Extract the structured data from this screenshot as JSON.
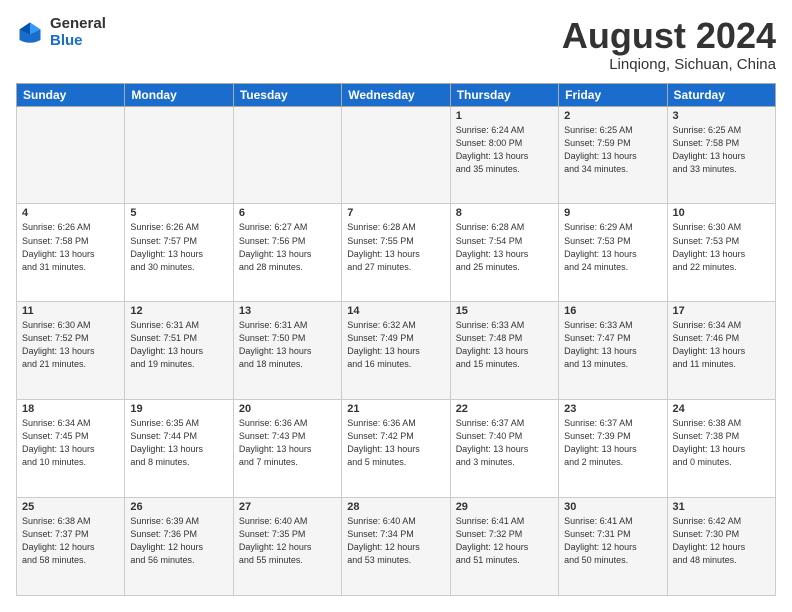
{
  "logo": {
    "general": "General",
    "blue": "Blue"
  },
  "title": "August 2024",
  "location": "Linqiong, Sichuan, China",
  "weekdays": [
    "Sunday",
    "Monday",
    "Tuesday",
    "Wednesday",
    "Thursday",
    "Friday",
    "Saturday"
  ],
  "weeks": [
    [
      {
        "day": "",
        "info": ""
      },
      {
        "day": "",
        "info": ""
      },
      {
        "day": "",
        "info": ""
      },
      {
        "day": "",
        "info": ""
      },
      {
        "day": "1",
        "info": "Sunrise: 6:24 AM\nSunset: 8:00 PM\nDaylight: 13 hours\nand 35 minutes."
      },
      {
        "day": "2",
        "info": "Sunrise: 6:25 AM\nSunset: 7:59 PM\nDaylight: 13 hours\nand 34 minutes."
      },
      {
        "day": "3",
        "info": "Sunrise: 6:25 AM\nSunset: 7:58 PM\nDaylight: 13 hours\nand 33 minutes."
      }
    ],
    [
      {
        "day": "4",
        "info": "Sunrise: 6:26 AM\nSunset: 7:58 PM\nDaylight: 13 hours\nand 31 minutes."
      },
      {
        "day": "5",
        "info": "Sunrise: 6:26 AM\nSunset: 7:57 PM\nDaylight: 13 hours\nand 30 minutes."
      },
      {
        "day": "6",
        "info": "Sunrise: 6:27 AM\nSunset: 7:56 PM\nDaylight: 13 hours\nand 28 minutes."
      },
      {
        "day": "7",
        "info": "Sunrise: 6:28 AM\nSunset: 7:55 PM\nDaylight: 13 hours\nand 27 minutes."
      },
      {
        "day": "8",
        "info": "Sunrise: 6:28 AM\nSunset: 7:54 PM\nDaylight: 13 hours\nand 25 minutes."
      },
      {
        "day": "9",
        "info": "Sunrise: 6:29 AM\nSunset: 7:53 PM\nDaylight: 13 hours\nand 24 minutes."
      },
      {
        "day": "10",
        "info": "Sunrise: 6:30 AM\nSunset: 7:53 PM\nDaylight: 13 hours\nand 22 minutes."
      }
    ],
    [
      {
        "day": "11",
        "info": "Sunrise: 6:30 AM\nSunset: 7:52 PM\nDaylight: 13 hours\nand 21 minutes."
      },
      {
        "day": "12",
        "info": "Sunrise: 6:31 AM\nSunset: 7:51 PM\nDaylight: 13 hours\nand 19 minutes."
      },
      {
        "day": "13",
        "info": "Sunrise: 6:31 AM\nSunset: 7:50 PM\nDaylight: 13 hours\nand 18 minutes."
      },
      {
        "day": "14",
        "info": "Sunrise: 6:32 AM\nSunset: 7:49 PM\nDaylight: 13 hours\nand 16 minutes."
      },
      {
        "day": "15",
        "info": "Sunrise: 6:33 AM\nSunset: 7:48 PM\nDaylight: 13 hours\nand 15 minutes."
      },
      {
        "day": "16",
        "info": "Sunrise: 6:33 AM\nSunset: 7:47 PM\nDaylight: 13 hours\nand 13 minutes."
      },
      {
        "day": "17",
        "info": "Sunrise: 6:34 AM\nSunset: 7:46 PM\nDaylight: 13 hours\nand 11 minutes."
      }
    ],
    [
      {
        "day": "18",
        "info": "Sunrise: 6:34 AM\nSunset: 7:45 PM\nDaylight: 13 hours\nand 10 minutes."
      },
      {
        "day": "19",
        "info": "Sunrise: 6:35 AM\nSunset: 7:44 PM\nDaylight: 13 hours\nand 8 minutes."
      },
      {
        "day": "20",
        "info": "Sunrise: 6:36 AM\nSunset: 7:43 PM\nDaylight: 13 hours\nand 7 minutes."
      },
      {
        "day": "21",
        "info": "Sunrise: 6:36 AM\nSunset: 7:42 PM\nDaylight: 13 hours\nand 5 minutes."
      },
      {
        "day": "22",
        "info": "Sunrise: 6:37 AM\nSunset: 7:40 PM\nDaylight: 13 hours\nand 3 minutes."
      },
      {
        "day": "23",
        "info": "Sunrise: 6:37 AM\nSunset: 7:39 PM\nDaylight: 13 hours\nand 2 minutes."
      },
      {
        "day": "24",
        "info": "Sunrise: 6:38 AM\nSunset: 7:38 PM\nDaylight: 13 hours\nand 0 minutes."
      }
    ],
    [
      {
        "day": "25",
        "info": "Sunrise: 6:38 AM\nSunset: 7:37 PM\nDaylight: 12 hours\nand 58 minutes."
      },
      {
        "day": "26",
        "info": "Sunrise: 6:39 AM\nSunset: 7:36 PM\nDaylight: 12 hours\nand 56 minutes."
      },
      {
        "day": "27",
        "info": "Sunrise: 6:40 AM\nSunset: 7:35 PM\nDaylight: 12 hours\nand 55 minutes."
      },
      {
        "day": "28",
        "info": "Sunrise: 6:40 AM\nSunset: 7:34 PM\nDaylight: 12 hours\nand 53 minutes."
      },
      {
        "day": "29",
        "info": "Sunrise: 6:41 AM\nSunset: 7:32 PM\nDaylight: 12 hours\nand 51 minutes."
      },
      {
        "day": "30",
        "info": "Sunrise: 6:41 AM\nSunset: 7:31 PM\nDaylight: 12 hours\nand 50 minutes."
      },
      {
        "day": "31",
        "info": "Sunrise: 6:42 AM\nSunset: 7:30 PM\nDaylight: 12 hours\nand 48 minutes."
      }
    ]
  ]
}
